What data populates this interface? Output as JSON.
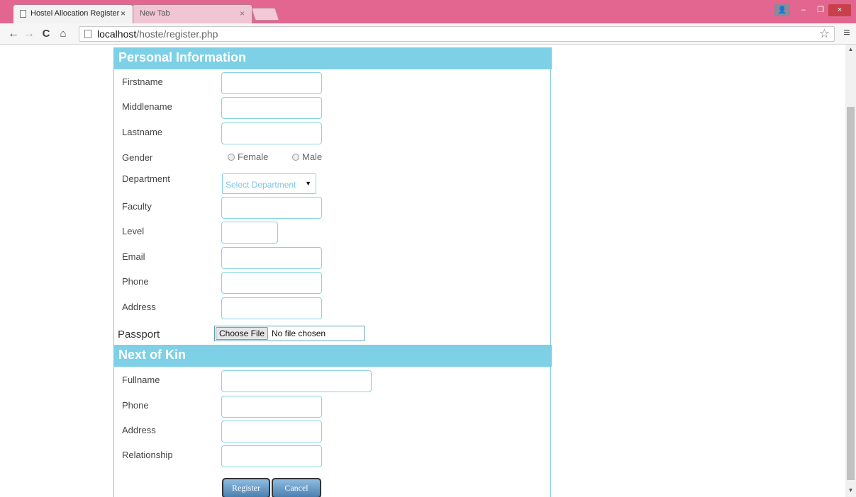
{
  "browser": {
    "tabs": [
      {
        "title": "Hostel Allocation Register",
        "active": true
      },
      {
        "title": "New Tab",
        "active": false
      }
    ],
    "close_glyph": "×",
    "url_host": "localhost",
    "url_path": "/hoste/register.php",
    "icons": {
      "back": "←",
      "forward": "→",
      "reload": "C",
      "home": "⌂",
      "star": "☆",
      "menu": "≡",
      "user": "👤",
      "minimize": "–",
      "maximize": "❐",
      "close": "×",
      "scroll_up": "▲",
      "scroll_down": "▼"
    },
    "colors": {
      "titlebar": "#e2668f",
      "header": "#7dd0e6"
    }
  },
  "form": {
    "personal": {
      "heading": "Personal Information",
      "firstname_label": "Firstname",
      "middlename_label": "Middlename",
      "lastname_label": "Lastname",
      "gender_label": "Gender",
      "gender_female": "Female",
      "gender_male": "Male",
      "department_label": "Department",
      "department_selected": "Select Department",
      "faculty_label": "Faculty",
      "level_label": "Level",
      "email_label": "Email",
      "phone_label": "Phone",
      "address_label": "Address",
      "passport_label": "Passport",
      "file_button": "Choose File",
      "file_status": "No file chosen"
    },
    "kin": {
      "heading": "Next of Kin",
      "fullname_label": "Fullname",
      "phone_label": "Phone",
      "address_label": "Address",
      "relationship_label": "Relationship"
    },
    "buttons": {
      "register": "Register",
      "cancel": "Cancel"
    }
  }
}
